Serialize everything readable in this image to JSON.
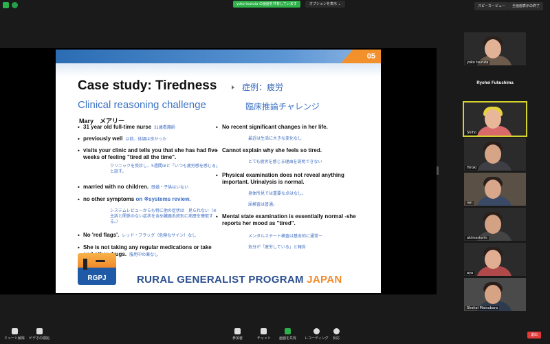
{
  "topbar": {
    "share_notice": "yoko tsuruta の画面を共有しています",
    "view_option": "オプションを表示 ⌄",
    "speaker_view": "スピーカービュー",
    "exit_fullscreen": "全画面表示の終了"
  },
  "slide": {
    "page_number": "05",
    "title_en": "Case study: Tiredness",
    "title_jp": "症例：疲労",
    "subtitle_en": "Clinical reasoning challenge",
    "subtitle_jp": "臨床推論チャレンジ",
    "patient": "Mary　メアリー",
    "left_items": [
      {
        "en": "31 year old full-time nurse",
        "jp": "31歳看護師"
      },
      {
        "en": "previously well",
        "jp": "以前、体調は良かった"
      },
      {
        "en": "visits your clinic and tells you that she has had five weeks of feeling \"tired all the time\".",
        "jp": "クリニックを受診し、5週間ほど「いつも疲労感を感じる」と話す。"
      },
      {
        "en": "married with no children.",
        "jp": "既婚・子供はいない"
      },
      {
        "en": "no other symptoms",
        "en_blue": "on ※systems review.",
        "jp": "システムレビューからも特に他の症状は　見られない（※主訴と関係のない症状を含め臓器系統別に病歴を聴取する。）"
      },
      {
        "en": "No 'red flags'.",
        "jp": "レッド・フラッグ（危険なサイン）なし"
      },
      {
        "en": "She is not taking any regular medications or take and other drugs.",
        "jp": "服用中の薬なし"
      }
    ],
    "right_items": [
      {
        "en": "No recent significant changes in her life.",
        "jp": "最近は生活に大きな変化なし"
      },
      {
        "en": "Cannot explain why she feels so tired.",
        "jp": "とても疲労を感じる理由を説明できない"
      },
      {
        "en": "Physical examination does not reveal anything important. Urinalysis is normal.",
        "jp1": "身体所見では重要な点はなし。",
        "jp2": "尿検査は普通。"
      },
      {
        "en": "Mental state examination is essentially normal -she reports her mood as \"tired\".",
        "jp1": "メンタルステート検査は基本的に通常ー",
        "jp2": "気分が「疲労している」と報告"
      }
    ],
    "logo_text": "RGPJ",
    "program_en": "RURAL GENERALIST PROGRAM",
    "program_jp_word": "JAPAN"
  },
  "gallery": [
    {
      "name": "yoko tsuruta",
      "kind": "video"
    },
    {
      "name": "Ryohei Fukushima",
      "kind": "name-only"
    },
    {
      "name": "Shiho",
      "kind": "video",
      "active": true
    },
    {
      "name": "Hiroki",
      "kind": "video"
    },
    {
      "name": "ren",
      "kind": "video"
    },
    {
      "name": "akimasterin",
      "kind": "video"
    },
    {
      "name": "aya",
      "kind": "video"
    },
    {
      "name": "Shohei Matsubara",
      "kind": "video"
    }
  ],
  "toolbar": {
    "mute": "ミュート解除",
    "video": "ビデオの開始",
    "participants": "参加者",
    "participants_count": "9",
    "chat": "チャット",
    "share": "画面を共有",
    "record": "レコーディング",
    "reactions": "反応",
    "leave": "退出"
  },
  "colors": {
    "accent_green": "#2bb24c",
    "slide_blue": "#3d6cc0",
    "orange": "#f08a2b",
    "leave_red": "#e03b3b"
  }
}
